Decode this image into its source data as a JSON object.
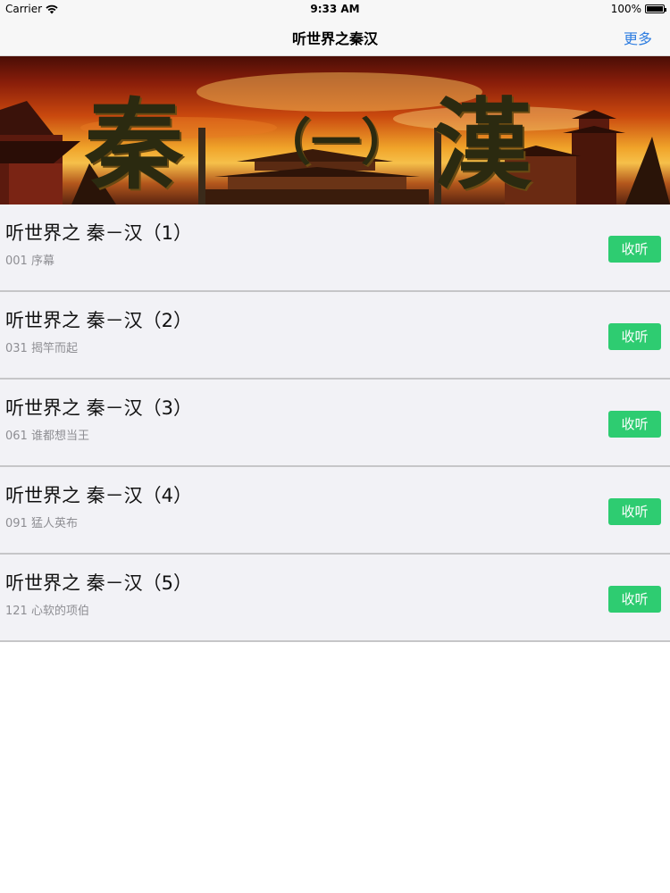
{
  "status_bar": {
    "carrier": "Carrier",
    "time": "9:33 AM",
    "battery": "100%",
    "wifi_icon": "wifi-icon",
    "battery_icon": "battery-icon"
  },
  "nav": {
    "title": "听世界之秦汉",
    "more": "更多"
  },
  "banner": {
    "left_char": "秦",
    "center_text": "（一）",
    "right_char": "漢"
  },
  "list": {
    "button_label": "收听",
    "items": [
      {
        "title": "听世界之 秦－汉（1）",
        "subtitle": "001 序幕"
      },
      {
        "title": "听世界之 秦－汉（2）",
        "subtitle": "031 揭竿而起"
      },
      {
        "title": "听世界之 秦－汉（3）",
        "subtitle": "061 谁都想当王"
      },
      {
        "title": "听世界之 秦－汉（4）",
        "subtitle": "091 猛人英布"
      },
      {
        "title": "听世界之 秦－汉（5）",
        "subtitle": "121 心软的项伯"
      }
    ]
  },
  "colors": {
    "accent": "#2e7de0",
    "button": "#2ecc71",
    "row_bg": "#f2f2f6",
    "separator": "#c6c6c8"
  }
}
